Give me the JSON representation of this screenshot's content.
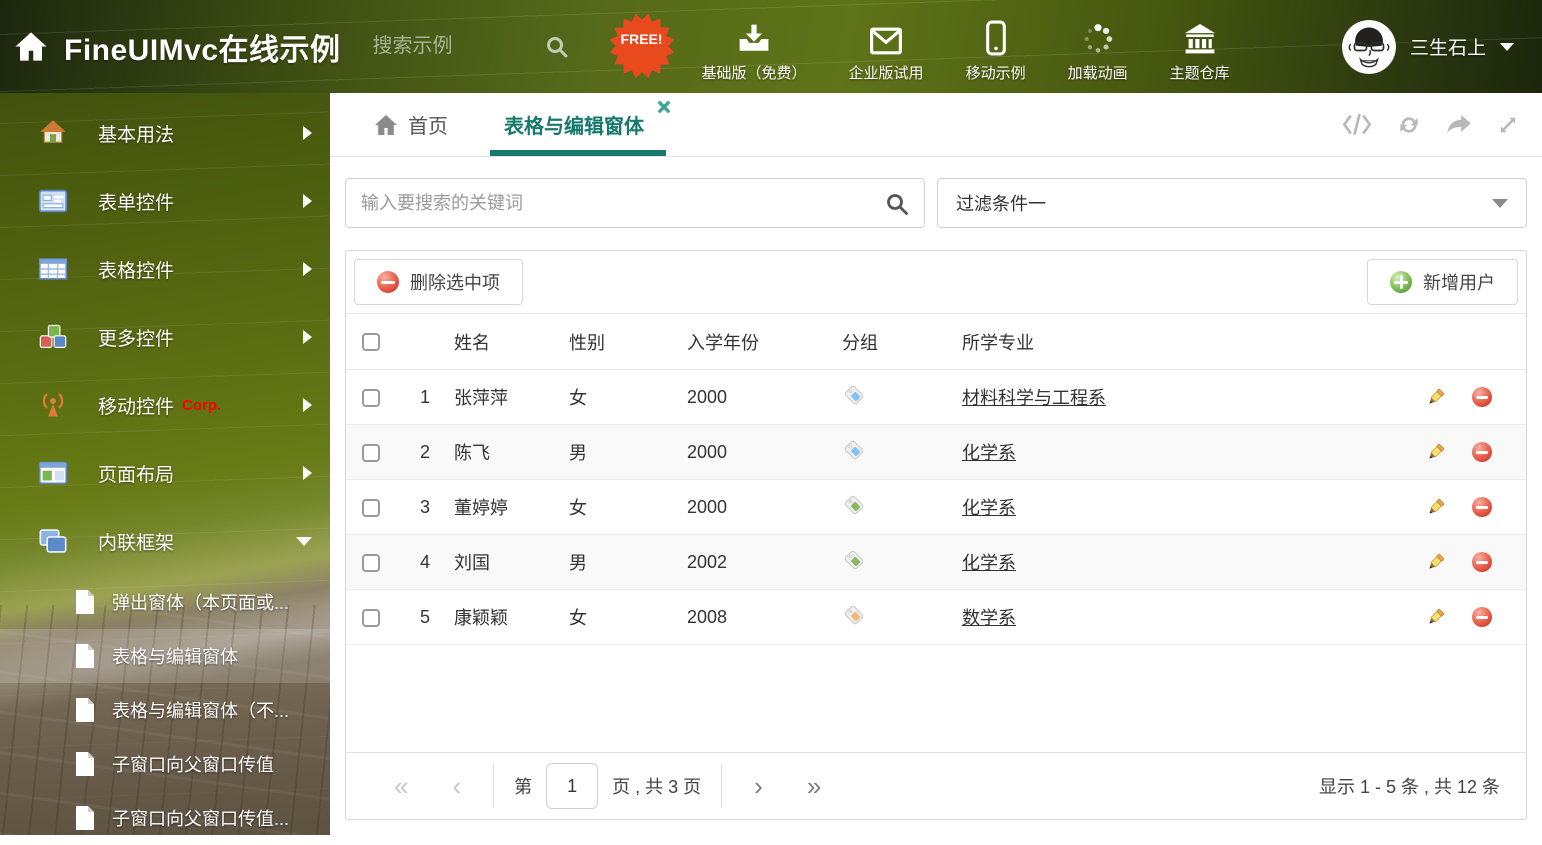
{
  "colors": {
    "accent": "#17796b",
    "danger": "#d8402e",
    "success": "#5da33a",
    "tag-blue": "#7fc4f4",
    "tag-green": "#8ab65f",
    "tag-orange": "#f5b573",
    "free-badge": "#e8491d",
    "corp-red": "#ff0000"
  },
  "header": {
    "title": "FineUIMvc在线示例",
    "search_placeholder": "搜索示例",
    "free_badge": "FREE!",
    "nav": [
      {
        "label": "基础版（免费）",
        "icon": "download-icon"
      },
      {
        "label": "企业版试用",
        "icon": "envelope-icon"
      },
      {
        "label": "移动示例",
        "icon": "mobile-icon"
      },
      {
        "label": "加载动画",
        "icon": "spinner-icon"
      },
      {
        "label": "主题仓库",
        "icon": "bank-icon"
      }
    ],
    "username": "三生石上"
  },
  "sidebar": {
    "items": [
      {
        "label": "基本用法",
        "icon": "home-icon"
      },
      {
        "label": "表单控件",
        "icon": "form-icon"
      },
      {
        "label": "表格控件",
        "icon": "table-icon"
      },
      {
        "label": "更多控件",
        "icon": "cubes-icon"
      },
      {
        "label": "移动控件",
        "badge": "Corp.",
        "icon": "antenna-icon"
      },
      {
        "label": "页面布局",
        "icon": "layout-icon"
      },
      {
        "label": "内联框架",
        "icon": "frames-icon",
        "expanded": true
      }
    ],
    "submenu": [
      "弹出窗体（本页面或...",
      "表格与编辑窗体",
      "表格与编辑窗体（不...",
      "子窗口向父窗口传值",
      "子窗口向父窗口传值..."
    ],
    "selected_submenu_index": 1
  },
  "tabs": {
    "home_label": "首页",
    "active_label": "表格与编辑窗体"
  },
  "search_bar": {
    "placeholder": "输入要搜索的关键词"
  },
  "filter": {
    "value": "过滤条件一"
  },
  "toolbar": {
    "delete_label": "删除选中项",
    "add_label": "新增用户"
  },
  "table": {
    "columns": [
      "姓名",
      "性别",
      "入学年份",
      "分组",
      "所学专业"
    ],
    "rows": [
      {
        "num": "1",
        "name": "张萍萍",
        "gender": "女",
        "year": "2000",
        "tag": "blue",
        "major": "材料科学与工程系"
      },
      {
        "num": "2",
        "name": "陈飞",
        "gender": "男",
        "year": "2000",
        "tag": "blue",
        "major": "化学系"
      },
      {
        "num": "3",
        "name": "董婷婷",
        "gender": "女",
        "year": "2000",
        "tag": "green",
        "major": "化学系"
      },
      {
        "num": "4",
        "name": "刘国",
        "gender": "男",
        "year": "2002",
        "tag": "green",
        "major": "化学系"
      },
      {
        "num": "5",
        "name": "康颖颖",
        "gender": "女",
        "year": "2008",
        "tag": "orange",
        "major": "数学系"
      }
    ]
  },
  "pager": {
    "first": "«",
    "prev": "‹",
    "page_prefix": "第",
    "page_value": "1",
    "page_suffix": "页 , 共 3 页",
    "next": "›",
    "last": "»",
    "summary": "显示 1 - 5 条 , 共 12 条"
  }
}
